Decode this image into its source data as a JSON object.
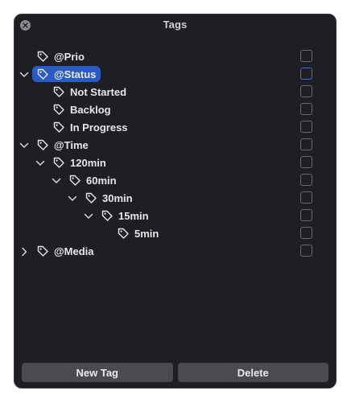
{
  "window": {
    "title": "Tags"
  },
  "tree": {
    "items": [
      {
        "label": "@Prio",
        "level": 0,
        "disclosure": "none",
        "selected": false
      },
      {
        "label": "@Status",
        "level": 0,
        "disclosure": "expanded",
        "selected": true
      },
      {
        "label": "Not Started",
        "level": 1,
        "disclosure": "none",
        "selected": false
      },
      {
        "label": "Backlog",
        "level": 1,
        "disclosure": "none",
        "selected": false
      },
      {
        "label": "In Progress",
        "level": 1,
        "disclosure": "none",
        "selected": false
      },
      {
        "label": "@Time",
        "level": 0,
        "disclosure": "expanded",
        "selected": false
      },
      {
        "label": "120min",
        "level": 1,
        "disclosure": "expanded",
        "selected": false
      },
      {
        "label": "60min",
        "level": 2,
        "disclosure": "expanded",
        "selected": false
      },
      {
        "label": "30min",
        "level": 3,
        "disclosure": "expanded",
        "selected": false
      },
      {
        "label": "15min",
        "level": 4,
        "disclosure": "expanded",
        "selected": false
      },
      {
        "label": "5min",
        "level": 5,
        "disclosure": "none",
        "selected": false
      },
      {
        "label": "@Media",
        "level": 0,
        "disclosure": "collapsed",
        "selected": false
      }
    ]
  },
  "footer": {
    "new_tag_label": "New Tag",
    "delete_label": "Delete"
  },
  "icons": {
    "close": "close-icon",
    "tag": "tag-icon",
    "expanded": "chevron-down-icon",
    "collapsed": "chevron-right-icon"
  },
  "colors": {
    "window_bg": "#1e1f22",
    "selection": "#2a5bc4",
    "button_bg": "#4a4b4e",
    "text": "#e8e8ea"
  }
}
